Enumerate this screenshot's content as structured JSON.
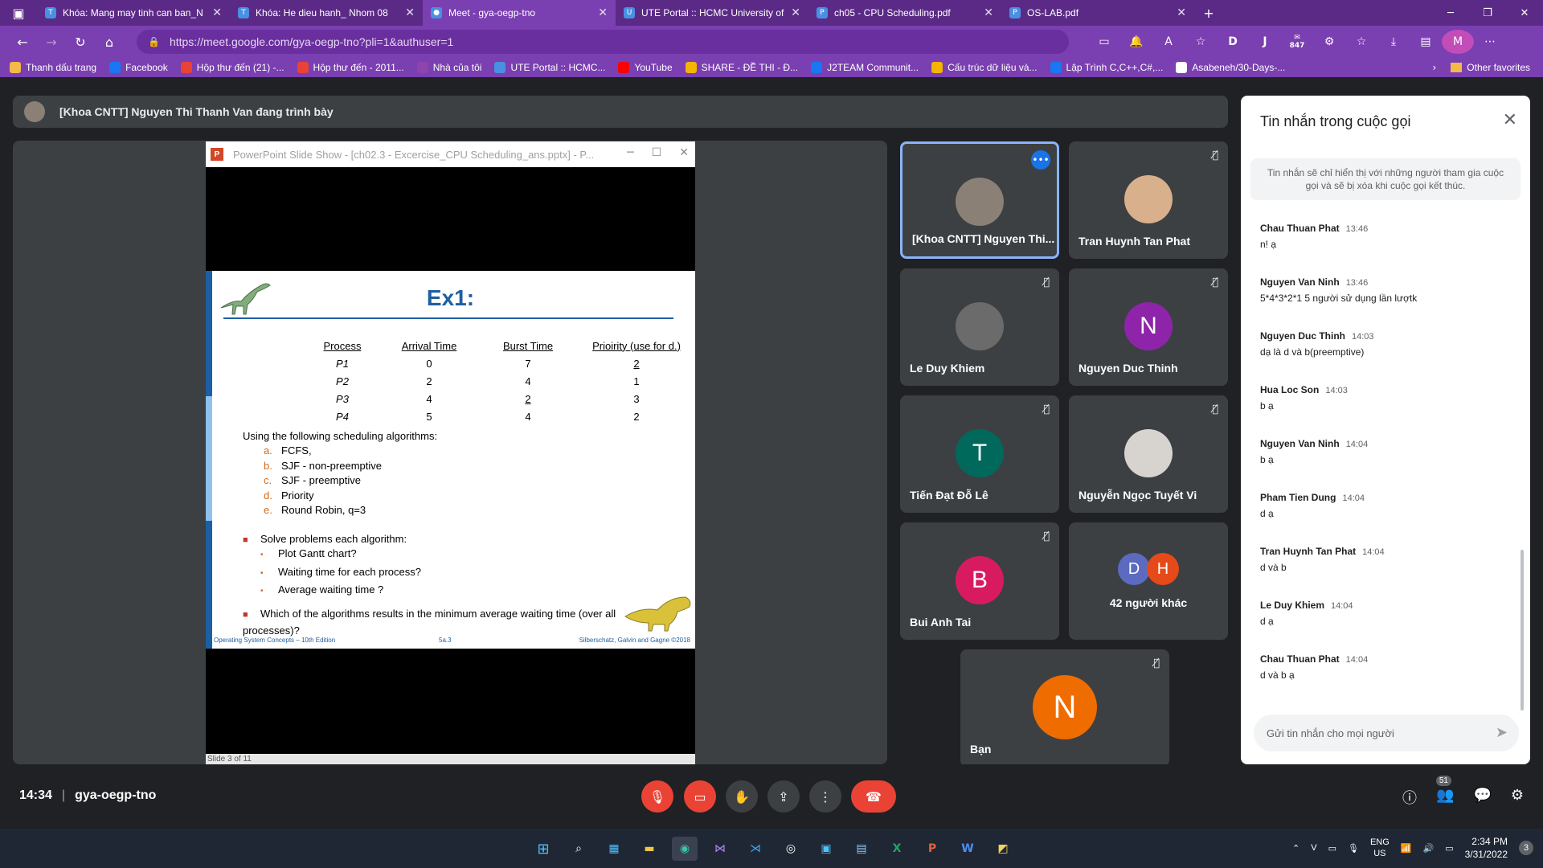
{
  "browser": {
    "tabs": [
      {
        "title": "Khóa: Mang may tinh can ban_N",
        "fav": "T"
      },
      {
        "title": "Khóa: He dieu hanh_ Nhom 08",
        "fav": "T"
      },
      {
        "title": "Meet - gya-oegp-tno",
        "fav": "●"
      },
      {
        "title": "UTE Portal :: HCMC University of",
        "fav": "U"
      },
      {
        "title": "ch05 - CPU Scheduling.pdf",
        "fav": "P"
      },
      {
        "title": "OS-LAB.pdf",
        "fav": "P"
      }
    ],
    "url": "https://meet.google.com/gya-oegp-tno?pli=1&authuser=1",
    "profile_initial": "M",
    "ext_badge": "847",
    "bookmarks": [
      "Thanh dấu trang",
      "Facebook",
      "Hộp thư đến (21) -...",
      "Hộp thư đến - 2011...",
      "Nhà của tôi",
      "UTE Portal :: HCMC...",
      "YouTube",
      "SHARE - ĐỀ THI - Đ...",
      "J2TEAM Communit...",
      "Cấu trúc dữ liệu và...",
      "Lập Trình C,C++,C#,...",
      "Asabeneh/30-Days-..."
    ],
    "other_favorites": "Other favorites"
  },
  "meet": {
    "presenter": "[Khoa CNTT] Nguyen Thi Thanh Van đang trình bày",
    "meeting_code": "gya-oegp-tno",
    "time": "14:34",
    "people_count": "51"
  },
  "ppt": {
    "window_title": "PowerPoint Slide Show - [ch02.3 - Excercise_CPU Scheduling_ans.pptx] - P...",
    "status": "Slide 3 of 11",
    "slide": {
      "heading": "Ex1:",
      "headers": [
        "Process",
        "Arrival Time",
        "Burst Time",
        "Prioirity (use for d.)"
      ],
      "rows": [
        [
          "P1",
          "0",
          "7",
          "2"
        ],
        [
          "P2",
          "2",
          "4",
          "1"
        ],
        [
          "P3",
          "4",
          "2",
          "3"
        ],
        [
          "P4",
          "5",
          "4",
          "2"
        ]
      ],
      "intro": "Using the following scheduling algorithms:",
      "algorithms": [
        {
          "mark": "a.",
          "text": "FCFS,"
        },
        {
          "mark": "b.",
          "text": "SJF - non-preemptive"
        },
        {
          "mark": "c.",
          "text": "SJF - preemptive"
        },
        {
          "mark": "d.",
          "text": "Priority"
        },
        {
          "mark": "e.",
          "text": "Round Robin, q=3"
        }
      ],
      "solve": "Solve problems each algorithm:",
      "subtasks": [
        "Plot Gantt chart?",
        "Waiting time for each process?",
        "Average waiting time ?"
      ],
      "question": "Which of the algorithms results in the minimum average waiting time (over all processes)?",
      "footer_left": "Operating System Concepts – 10th Edition",
      "footer_center": "5a.3",
      "footer_right": "Silberschatz, Galvin and Gagne ©2018"
    }
  },
  "participants": [
    {
      "name": "[Khoa CNTT] Nguyen Thi...",
      "initial": "",
      "color": "#8a8076"
    },
    {
      "name": "Tran Huynh Tan Phat",
      "initial": "",
      "color": "#d9b08c"
    },
    {
      "name": "Le Duy Khiem",
      "initial": "",
      "color": "#6b6b6b"
    },
    {
      "name": "Nguyen Duc Thinh",
      "initial": "N",
      "color": "#8e24aa"
    },
    {
      "name": "Tiến Đạt Đỗ Lê",
      "initial": "T",
      "color": "#00695c"
    },
    {
      "name": "Nguyễn Ngọc Tuyết Vi",
      "initial": "",
      "color": "#d7d3cf"
    },
    {
      "name": "Bui Anh Tai",
      "initial": "B",
      "color": "#d81b60"
    },
    {
      "name": "42 người khác",
      "initial": "",
      "color": ""
    },
    {
      "name": "Bạn",
      "initial": "N",
      "color": "#ef6c00"
    }
  ],
  "others_avatars": [
    {
      "initial": "D",
      "color": "#5c6bc0"
    },
    {
      "initial": "H",
      "color": "#e64a19"
    }
  ],
  "chat": {
    "title": "Tin nhắn trong cuộc gọi",
    "note": "Tin nhắn sẽ chỉ hiển thị với những người tham gia cuộc gọi và sẽ bị xóa khi cuộc gọi kết thúc.",
    "messages": [
      {
        "who": "Chau Thuan Phat",
        "time": "13:46",
        "text": "n! ạ"
      },
      {
        "who": "Nguyen Van Ninh",
        "time": "13:46",
        "text": "5*4*3*2*1 5 người sử dụng lần lượtk"
      },
      {
        "who": "Nguyen Duc Thinh",
        "time": "14:03",
        "text": "dạ là d và b(preemptive)"
      },
      {
        "who": "Hua Loc Son",
        "time": "14:03",
        "text": "b ạ"
      },
      {
        "who": "Nguyen Van Ninh",
        "time": "14:04",
        "text": "b ạ"
      },
      {
        "who": "Pham Tien Dung",
        "time": "14:04",
        "text": "d ạ"
      },
      {
        "who": "Tran Huynh Tan Phat",
        "time": "14:04",
        "text": "d và b"
      },
      {
        "who": "Le Duy Khiem",
        "time": "14:04",
        "text": "d ạ"
      },
      {
        "who": "Chau Thuan Phat",
        "time": "14:04",
        "text": "d và b ạ"
      }
    ],
    "placeholder": "Gửi tin nhắn cho mọi người"
  },
  "taskbar": {
    "lang": "ENG",
    "region": "US",
    "time": "2:34 PM",
    "date": "3/31/2022",
    "notif": "3"
  }
}
